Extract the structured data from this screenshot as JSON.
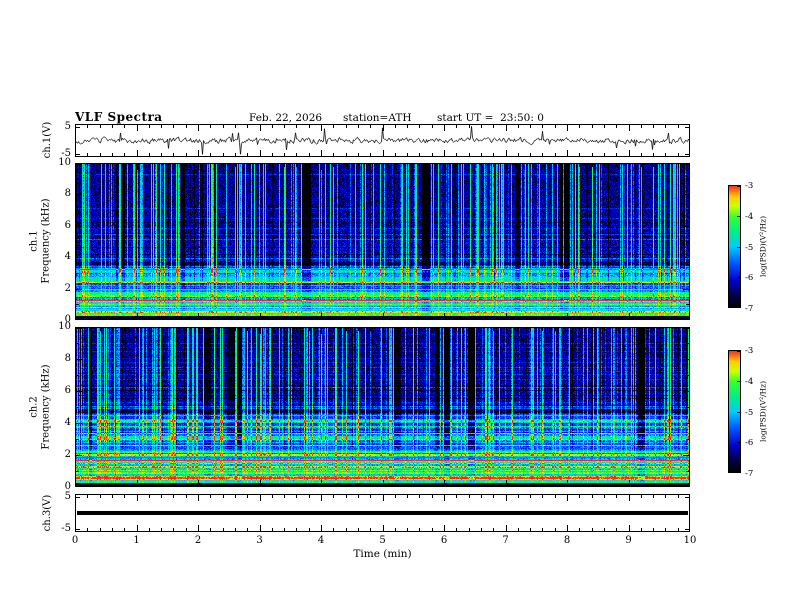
{
  "title": "VLF Spectra",
  "header": {
    "date": "Feb. 22, 2026",
    "station": "station=ATH",
    "start_ut": "start UT =  23:50: 0"
  },
  "axes": {
    "x": {
      "label": "Time (min)",
      "ticks": [
        "0",
        "1",
        "2",
        "3",
        "4",
        "5",
        "6",
        "7",
        "8",
        "9",
        "10"
      ]
    },
    "ch1_wave": {
      "ylabel": "ch.1(V)",
      "yticks": [
        "5",
        "-5"
      ]
    },
    "ch1_spec": {
      "ylabel_line1": "ch.1",
      "ylabel_line2": "Frequency (kHz)",
      "yticks": [
        "0",
        "2",
        "4",
        "6",
        "8",
        "10"
      ]
    },
    "ch2_spec": {
      "ylabel_line1": "ch.2",
      "ylabel_line2": "Frequency (kHz)",
      "yticks": [
        "0",
        "2",
        "4",
        "6",
        "8",
        "10"
      ]
    },
    "ch3_wave": {
      "ylabel": "ch.3(V)",
      "yticks": [
        "5",
        "-5"
      ]
    }
  },
  "colorbar": {
    "label": "log(PSD)(V²/Hz)",
    "ticks": [
      "-3",
      "-4",
      "-5",
      "-6",
      "-7"
    ]
  },
  "chart_data": {
    "type": "heatmap",
    "title": "VLF Spectra",
    "annotations": [
      "Feb. 22, 2026",
      "station=ATH",
      "start UT =  23:50: 0"
    ],
    "x": {
      "label": "Time (min)",
      "range": [
        0,
        10
      ],
      "ticks": [
        0,
        1,
        2,
        3,
        4,
        5,
        6,
        7,
        8,
        9,
        10
      ],
      "minor_tick_step": 0.2
    },
    "panels": [
      {
        "id": "ch1_waveform",
        "type": "line",
        "ylabel": "ch.1(V)",
        "yrange": [
          -5,
          5
        ],
        "ytick_values": [
          5,
          -5
        ],
        "summary": "Broadband noise of roughly ±1 V about 0 V with frequent impulsive spikes reaching about ±4 V across the whole 10 minutes."
      },
      {
        "id": "ch1_spectrogram",
        "type": "heatmap",
        "ylabel": "ch.1 Frequency (kHz)",
        "yrange": [
          0,
          10
        ],
        "ytick_values": [
          0,
          2,
          4,
          6,
          8,
          10
        ],
        "zrange": [
          -7,
          -3
        ],
        "summary": "Dark-blue background above ~3 kHz crossed by dense bright cyan/green vertical sferic streaks and a few wide darker columns; dense green/yellow horizontal banding (power-line harmonics) below ~3 kHz with occasional orange/red lines; thin black band at 0 kHz."
      },
      {
        "id": "ch2_spectrogram",
        "type": "heatmap",
        "ylabel": "ch.2 Frequency (kHz)",
        "yrange": [
          0,
          10
        ],
        "ytick_values": [
          0,
          2,
          4,
          6,
          8,
          10
        ],
        "zrange": [
          -7,
          -3
        ],
        "summary": "Similar impulsive vertical streaks above ~5 kHz on a dark-blue background; stronger and more extensive yellow/green horizontal banding up to ~4.5 kHz, with a strong orange/red line near 2 kHz and a dark line near 4.7 kHz; thin black band at 0 kHz."
      },
      {
        "id": "ch3_waveform",
        "type": "line",
        "ylabel": "ch.3(V)",
        "yrange": [
          -5,
          5
        ],
        "ytick_values": [
          5,
          -5
        ],
        "summary": "Completely flat thick black trace at 0 V for the full 10 minutes (channel inactive)."
      }
    ],
    "colorbar": {
      "label": "log(PSD)(V²/Hz)",
      "range": [
        -7,
        -3
      ],
      "ticks": [
        -3,
        -4,
        -5,
        -6,
        -7
      ],
      "position": "right"
    },
    "colormap_stops": [
      [
        0.0,
        "#000000"
      ],
      [
        0.1,
        "#000046"
      ],
      [
        0.22,
        "#0000cc"
      ],
      [
        0.36,
        "#0055ff"
      ],
      [
        0.5,
        "#00ccff"
      ],
      [
        0.62,
        "#00ee88"
      ],
      [
        0.74,
        "#33ff33"
      ],
      [
        0.83,
        "#ccff00"
      ],
      [
        0.91,
        "#ffcc00"
      ],
      [
        1.0,
        "#ff2222"
      ]
    ]
  }
}
